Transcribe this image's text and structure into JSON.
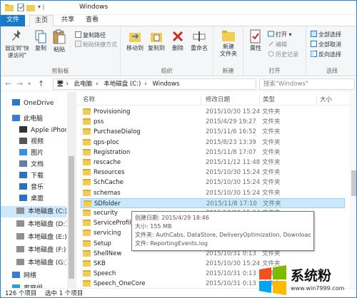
{
  "window": {
    "title": "Windows"
  },
  "ribbon_tabs": [
    "文件",
    "主页",
    "共享",
    "查看"
  ],
  "ribbon": {
    "clipboard": {
      "label": "剪贴板",
      "pin": "固定到\"快速访问\"",
      "copy": "复制",
      "paste": "粘贴",
      "copy_path": "复制路径",
      "paste_shortcut": "粘贴快捷方式"
    },
    "organize": {
      "label": "组织",
      "move_to": "移动到",
      "copy_to": "复制到",
      "delete": "删除",
      "rename": "重命名"
    },
    "new": {
      "label": "新建",
      "new_folder": "新建\n文件夹"
    },
    "open": {
      "label": "打开",
      "properties": "属性",
      "open_btn": "打开",
      "edit": "编辑",
      "history": "历史记录"
    },
    "select": {
      "label": "选择",
      "select_all": "全部选择",
      "select_none": "全部取消",
      "invert": "反向选择"
    }
  },
  "address": {
    "crumbs": [
      "此电脑",
      "本地磁盘 (C:)",
      "Windows"
    ],
    "search_placeholder": "搜索\"Windows\""
  },
  "nav": {
    "items": [
      "OneDrive",
      "此电脑",
      "Apple iPhone",
      "视频",
      "图片",
      "文档",
      "下载",
      "音乐",
      "桌面",
      "本地磁盘 (C:)",
      "本地磁盘 (D:)",
      "本地磁盘 (E:)",
      "本地磁盘 (F:)",
      "本地磁盘 (G:)",
      "网络",
      "家庭组"
    ],
    "selected_index": 9
  },
  "columns": [
    "名称",
    "修改日期",
    "类型",
    "大小"
  ],
  "files": [
    {
      "name": "Provisioning",
      "date": "2015/10/30 15:24",
      "type": "文件夹"
    },
    {
      "name": "pss",
      "date": "2015/4/29 19:27",
      "type": "文件夹"
    },
    {
      "name": "PurchaseDialog",
      "date": "2015/11/6 16:52",
      "type": "文件夹"
    },
    {
      "name": "qps-ploc",
      "date": "2015/8/23 13:39",
      "type": "文件夹"
    },
    {
      "name": "Registration",
      "date": "2015/11/8 17:07",
      "type": "文件夹"
    },
    {
      "name": "rescache",
      "date": "2015/11/12 11:48",
      "type": "文件夹"
    },
    {
      "name": "Resources",
      "date": "2015/10/30 15:24",
      "type": "文件夹"
    },
    {
      "name": "SchCache",
      "date": "2015/10/30 15:24",
      "type": "文件夹"
    },
    {
      "name": "schemas",
      "date": "2015/10/30 15:24",
      "type": "文件夹"
    },
    {
      "name": "SDfolder",
      "date": "2015/11/8 17:10",
      "type": "文件夹"
    },
    {
      "name": "security",
      "date": "2015/10/30 15:24",
      "type": "文件夹"
    },
    {
      "name": "ServiceProfiles",
      "date": "",
      "type": ""
    },
    {
      "name": "servicing",
      "date": "",
      "type": ""
    },
    {
      "name": "Setup",
      "date": "",
      "type": ""
    },
    {
      "name": "ShellNew",
      "date": "2015/10/31 0:13",
      "type": "文件夹"
    },
    {
      "name": "SKB",
      "date": "2015/10/30 15:24",
      "type": "文件夹"
    },
    {
      "name": "Speech",
      "date": "2015/10/31 0:13",
      "type": "文件夹"
    },
    {
      "name": "Speech_OneCore",
      "date": "2015/10/31 0:13",
      "type": "文件夹"
    }
  ],
  "selected_file_index": 9,
  "tooltip": {
    "created": "创建日期: 2015/4/29 18:46",
    "size": "大小: 155 MB",
    "folders": "文件夹: AuthCabs, DataStore, DeliveryOptimization, Download, ...",
    "files": "文件: ReportingEvents.log"
  },
  "status": {
    "count": "126 个项目",
    "selected": "选中 1 个项目"
  },
  "watermark": {
    "text": "系统粉",
    "url": "www.win7999.com"
  },
  "colors": {
    "accent": "#1979ca",
    "selection": "#cce8ff",
    "folder": "#f2cc55"
  }
}
